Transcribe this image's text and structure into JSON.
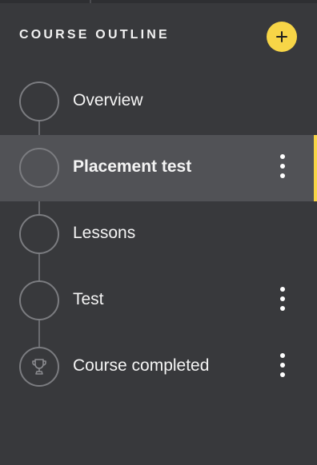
{
  "header": {
    "title": "COURSE OUTLINE",
    "add_icon": "plus-icon",
    "accent_color": "#f7d547"
  },
  "outline": {
    "steps": [
      {
        "label": "Overview",
        "icon": "empty-circle",
        "selected": false,
        "has_menu": false
      },
      {
        "label": "Placement test",
        "icon": "empty-circle",
        "selected": true,
        "has_menu": true
      },
      {
        "label": "Lessons",
        "icon": "empty-circle",
        "selected": false,
        "has_menu": false
      },
      {
        "label": "Test",
        "icon": "empty-circle",
        "selected": false,
        "has_menu": true
      },
      {
        "label": "Course completed",
        "icon": "trophy-icon",
        "selected": false,
        "has_menu": true
      }
    ],
    "menu_icon": "more-vertical-icon"
  }
}
